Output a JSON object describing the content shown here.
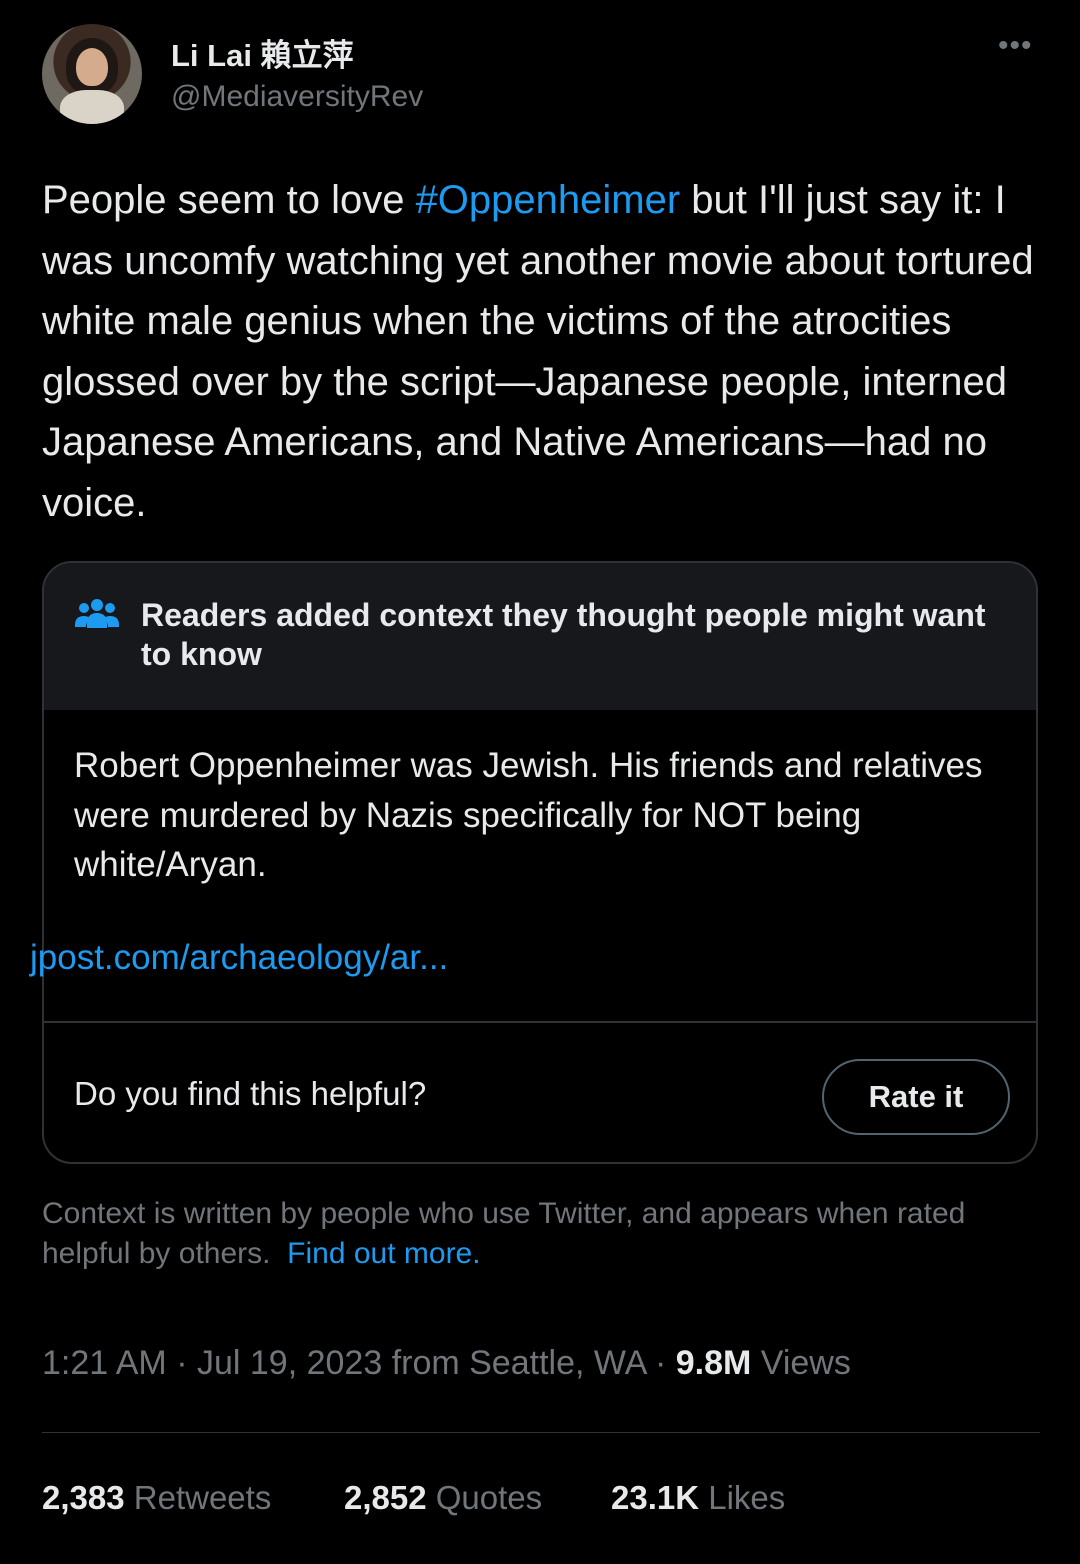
{
  "author": {
    "name": "Li Lai 賴立萍",
    "handle": "@MediaversityRev"
  },
  "tweet": {
    "text_before": "People seem to love ",
    "hashtag": "#Oppenheimer",
    "text_after": " but I'll just say it: I was uncomfy watching yet another movie about tortured white male genius when the victims of the atrocities glossed over by the script—Japanese people, interned Japanese Americans, and Native Americans—had no voice."
  },
  "note": {
    "title": "Readers added context they thought people might want to know",
    "body": "Robert Oppenheimer was Jewish. His friends and relatives were murdered by Nazis specifically for NOT being white/Aryan.",
    "link": "jpost.com/archaeology/ar...",
    "helpful_question": "Do you find this helpful?",
    "rate_label": "Rate it"
  },
  "disclaimer": {
    "text": "Context is written by people who use Twitter, and appears when rated helpful by others.",
    "link": "Find out more",
    "link_suffix": "."
  },
  "meta": {
    "time": "1:21 AM",
    "date": "Jul 19, 2023",
    "location": "from Seattle, WA",
    "views_count": "9.8M",
    "views_label": "Views"
  },
  "stats": [
    {
      "count": "2,383",
      "label": "Retweets"
    },
    {
      "count": "2,852",
      "label": "Quotes"
    },
    {
      "count": "23.1K",
      "label": "Likes"
    }
  ],
  "icons": {
    "more": "more-options-icon",
    "readers": "readers-icon"
  },
  "colors": {
    "background": "#000000",
    "text": "#e7e9ea",
    "secondary": "#71767b",
    "accent": "#1d9bf0"
  }
}
